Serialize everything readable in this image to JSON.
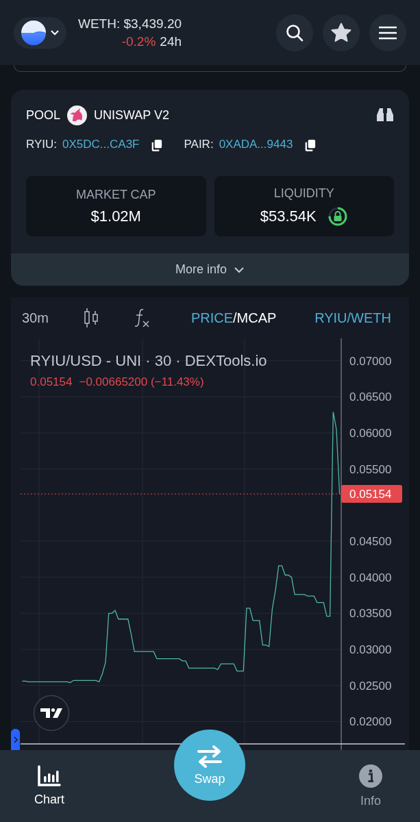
{
  "header": {
    "token_price": "WETH: $3,439.20",
    "change": "-0.2%",
    "period": "24h"
  },
  "pool": {
    "label": "POOL",
    "dex": "UNISWAP V2",
    "token_label": "RYIU:",
    "token_address": "0X5DC...CA3F",
    "pair_label": "PAIR:",
    "pair_address": "0XADA...9443",
    "stats": [
      {
        "kind": "plain",
        "label": "MARKET CAP",
        "value": "$1.02M"
      },
      {
        "kind": "locked",
        "label": "LIQUIDITY",
        "value": "$53.54K",
        "level": 0.75
      }
    ],
    "more_info": "More info"
  },
  "chart_toolbar": {
    "interval": "30m",
    "modes": [
      {
        "label": "PRICE",
        "selected": true
      },
      {
        "label": "MCAP",
        "selected": false
      }
    ],
    "separator": "/",
    "pair": "RYIU/WETH"
  },
  "chart": {
    "legend": "RYIU/USD - UNI · 30 · DEXTools.io",
    "last": "0.05154",
    "change": "−0.00665200 (−11.43%)",
    "chart_data": {
      "type": "line",
      "ylim": [
        0.0169,
        0.0731
      ],
      "grid": true,
      "ref_lines": [
        {
          "axis": "y",
          "value": 0.05154,
          "label": "0.05154",
          "color": "#e5484d"
        }
      ],
      "yticks": [
        {
          "value": 0.02,
          "label": "0.02000"
        },
        {
          "value": 0.025,
          "label": "0.02500"
        },
        {
          "value": 0.03,
          "label": "0.03000"
        },
        {
          "value": 0.035,
          "label": "0.03500"
        },
        {
          "value": 0.04,
          "label": "0.04000"
        },
        {
          "value": 0.045,
          "label": "0.04500"
        },
        {
          "value": 0.055,
          "label": "0.05500"
        },
        {
          "value": 0.06,
          "label": "0.06000"
        },
        {
          "value": 0.065,
          "label": "0.06500"
        },
        {
          "value": 0.07,
          "label": "0.07000"
        }
      ],
      "categories": [
        null,
        null,
        null,
        null,
        null,
        null,
        null,
        null,
        null,
        null,
        null,
        null,
        null,
        null,
        null,
        null,
        null,
        null,
        null,
        null,
        null,
        null,
        null,
        null,
        null,
        null,
        null,
        null,
        null,
        null,
        null,
        null,
        null,
        null,
        null,
        null,
        null,
        null,
        null,
        null,
        null,
        null,
        null,
        null,
        null,
        null,
        null,
        null,
        null,
        null,
        null,
        null,
        null,
        null,
        null,
        null,
        null,
        null,
        null,
        null,
        null,
        null,
        null,
        null,
        null,
        null,
        null,
        null,
        null,
        null,
        null,
        null,
        null,
        null,
        null,
        null,
        null,
        null,
        null,
        null,
        null,
        null,
        null,
        null,
        null,
        null,
        null,
        null,
        null,
        null,
        null,
        null,
        null,
        null,
        null,
        null,
        null,
        null,
        null,
        null
      ],
      "series": [
        {
          "color": "#4fb6a8",
          "values": [
            0.0256,
            0.0256,
            0.0255,
            0.0255,
            0.0255,
            0.0255,
            0.0255,
            0.0255,
            0.0255,
            0.0255,
            0.0255,
            0.0255,
            0.0255,
            0.0255,
            0.0255,
            0.0254,
            0.0257,
            0.0257,
            0.0257,
            0.0257,
            0.0257,
            0.0257,
            0.0257,
            0.0257,
            0.0255,
            0.0266,
            0.0282,
            0.035,
            0.035,
            0.0354,
            0.0342,
            0.0342,
            0.0342,
            0.0342,
            0.0321,
            0.0297,
            0.0297,
            0.0297,
            0.0297,
            0.0297,
            0.0297,
            0.0297,
            0.0287,
            0.0287,
            0.0287,
            0.0287,
            0.0287,
            0.0287,
            0.0287,
            0.0287,
            0.0284,
            0.0284,
            0.0274,
            0.0274,
            0.0274,
            0.0274,
            0.0274,
            0.0274,
            0.0274,
            0.0274,
            0.0274,
            0.0272,
            0.028,
            0.028,
            0.028,
            0.028,
            0.028,
            0.027,
            0.027,
            0.027,
            0.0357,
            0.0357,
            0.034,
            0.034,
            0.034,
            0.0306,
            0.0306,
            0.0304,
            0.0356,
            0.0382,
            0.0416,
            0.0416,
            0.0403,
            0.0403,
            0.04,
            0.0376,
            0.0376,
            0.0376,
            0.0376,
            0.0374,
            0.0374,
            0.0374,
            0.0365,
            0.0365,
            0.0365,
            0.0346,
            0.0346,
            0.0629,
            0.0605,
            0.0515
          ]
        }
      ]
    }
  },
  "swap": {
    "label": "Swap"
  },
  "nav": [
    {
      "kind": "chart",
      "label": "Chart",
      "selected": true
    },
    {
      "kind": "info",
      "label": "Info",
      "selected": false
    }
  ]
}
